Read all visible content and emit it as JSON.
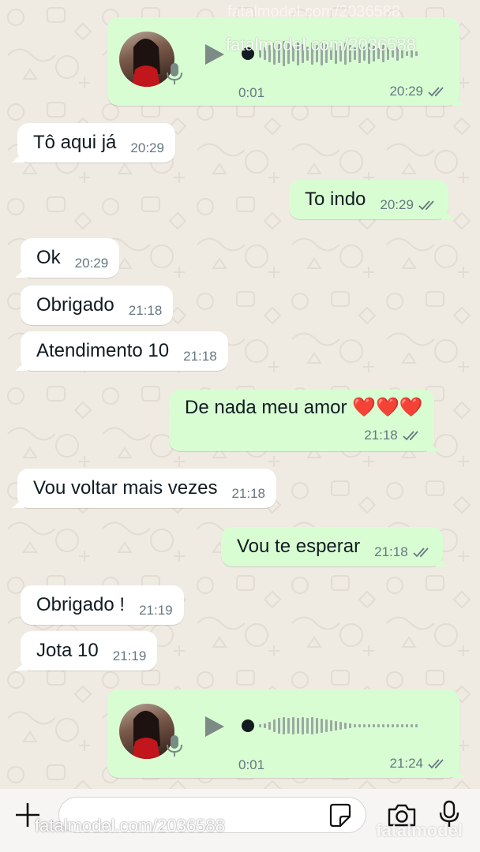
{
  "messages": [
    {
      "type": "voice",
      "direction": "out",
      "duration": "0:01",
      "time": "20:29",
      "status": "read"
    },
    {
      "type": "text",
      "direction": "in",
      "text": "Tô aqui já",
      "time": "20:29"
    },
    {
      "type": "text",
      "direction": "out",
      "text": "To indo",
      "time": "20:29",
      "status": "read"
    },
    {
      "type": "text",
      "direction": "in",
      "text": "Ok",
      "time": "20:29"
    },
    {
      "type": "text",
      "direction": "in",
      "text": "Obrigado",
      "time": "21:18"
    },
    {
      "type": "text",
      "direction": "in",
      "text": "Atendimento 10",
      "time": "21:18"
    },
    {
      "type": "text",
      "direction": "out",
      "text": "De nada meu amor ❤️❤️❤️",
      "time": "21:18",
      "status": "read"
    },
    {
      "type": "text",
      "direction": "in",
      "text": "Vou voltar mais vezes",
      "time": "21:18"
    },
    {
      "type": "text",
      "direction": "out",
      "text": "Vou te esperar",
      "time": "21:18",
      "status": "read"
    },
    {
      "type": "text",
      "direction": "in",
      "text": "Obrigado !",
      "time": "21:19"
    },
    {
      "type": "text",
      "direction": "in",
      "text": "Jota 10",
      "time": "21:19"
    },
    {
      "type": "voice",
      "direction": "out",
      "duration": "0:01",
      "time": "21:24",
      "status": "read"
    }
  ],
  "watermarks": {
    "top": "fatalmodel.com/2036588",
    "top_faint": "fatalmodel.com/2036588",
    "bottom": "fatalmodel.com/2036588",
    "bottom_right": "fatalmodel"
  },
  "composer": {
    "icons": [
      "plus-icon",
      "sticker-icon",
      "camera-icon",
      "microphone-icon"
    ]
  },
  "colors": {
    "chat_background": "#efeae2",
    "incoming_bubble": "#ffffff",
    "outgoing_bubble": "#d9fdd3",
    "meta_text": "#667781",
    "read_ticks": "#667781"
  }
}
